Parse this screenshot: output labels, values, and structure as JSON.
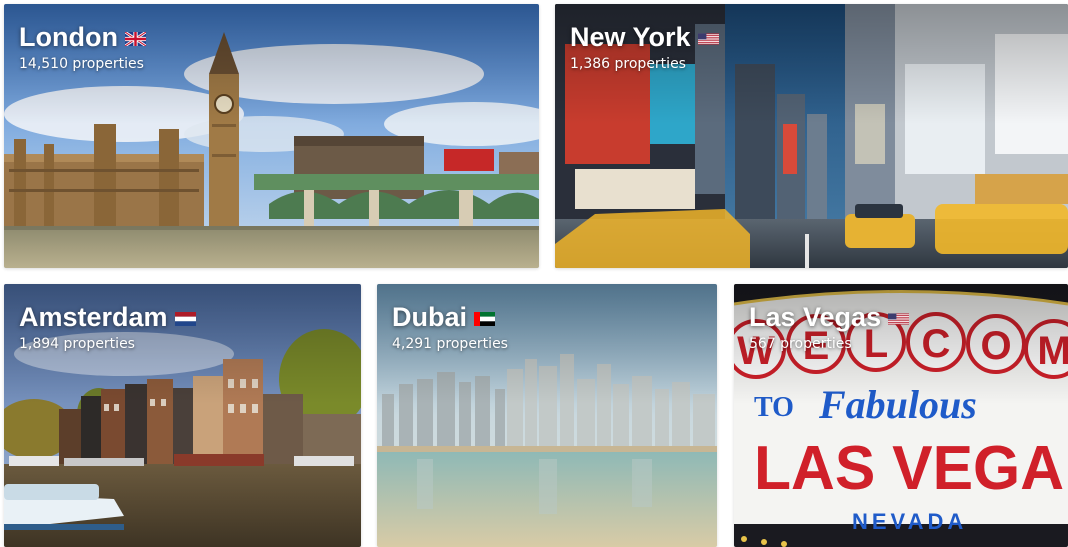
{
  "destinations": [
    {
      "city": "London",
      "count": "14,510 properties",
      "flag": "flag-uk-icon"
    },
    {
      "city": "New York",
      "count": "1,386 properties",
      "flag": "flag-us-icon"
    },
    {
      "city": "Amsterdam",
      "count": "1,894 properties",
      "flag": "flag-netherlands-icon"
    },
    {
      "city": "Dubai",
      "count": "4,291 properties",
      "flag": "flag-uae-icon"
    },
    {
      "city": "Las Vegas",
      "count": "567 properties",
      "flag": "flag-us-icon"
    }
  ],
  "las_vegas_sign": {
    "welcome": "WELCOME",
    "to_fabulous": "TO Fabulous",
    "las_vegas": "LAS VEGAS",
    "nevada": "NEVADA"
  },
  "colors": {
    "selected_outline": "#f0b429",
    "text": "#ffffff"
  }
}
